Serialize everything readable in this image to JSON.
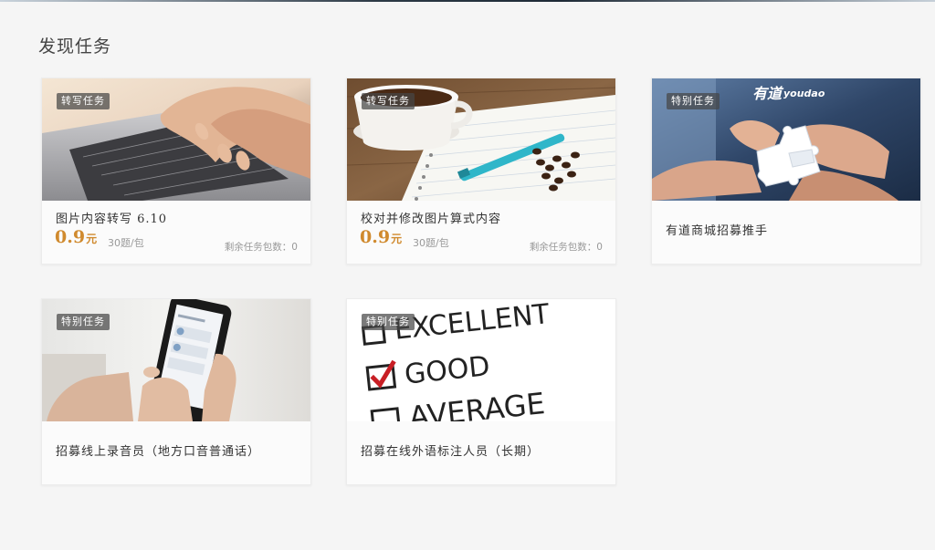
{
  "page": {
    "title": "发现任务"
  },
  "cards": [
    {
      "badge": "转写任务",
      "title": "图片内容转写 6.10",
      "price_value": "0.9",
      "price_unit": "元",
      "per_pack": "30题/包",
      "remaining": "剩余任务包数：0",
      "image": "typing-on-laptop"
    },
    {
      "badge": "转写任务",
      "title": "校对并修改图片算式内容",
      "price_value": "0.9",
      "price_unit": "元",
      "per_pack": "30题/包",
      "remaining": "剩余任务包数：0",
      "image": "coffee-notebook-pen"
    },
    {
      "badge": "特别任务",
      "title": "有道商城招募推手",
      "image": "hands-jigsaw-puzzle",
      "image_logo_text": "有道 youdao"
    },
    {
      "badge": "特别任务",
      "title": "招募线上录音员（地方口音普通话）",
      "image": "hands-holding-phone"
    },
    {
      "badge": "特别任务",
      "title": "招募在线外语标注人员（长期）",
      "image": "checklist-excellent-good-average",
      "image_words": [
        "EXCELLENT",
        "GOOD",
        "AVERAGE"
      ]
    }
  ]
}
